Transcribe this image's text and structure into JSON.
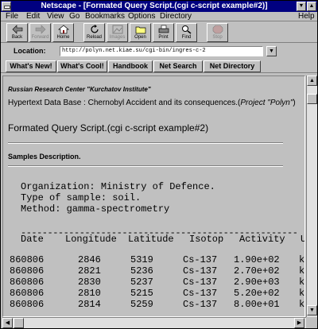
{
  "window": {
    "title": "Netscape - [Formated Query Script.(cgi c-script example#2)]",
    "minimize_glyph": "▼",
    "maximize_glyph": "▲"
  },
  "menu": [
    "File",
    "Edit",
    "View",
    "Go",
    "Bookmarks",
    "Options",
    "Directory",
    "Help"
  ],
  "toolbar": [
    {
      "label": "Back",
      "icon": "back-arrow-icon",
      "enabled": true
    },
    {
      "label": "Forward",
      "icon": "forward-arrow-icon",
      "enabled": false
    },
    {
      "label": "Home",
      "icon": "home-icon",
      "enabled": true
    },
    {
      "label": "Reload",
      "icon": "reload-icon",
      "enabled": true
    },
    {
      "label": "Images",
      "icon": "images-icon",
      "enabled": false
    },
    {
      "label": "Open",
      "icon": "open-icon",
      "enabled": true
    },
    {
      "label": "Print",
      "icon": "print-icon",
      "enabled": true
    },
    {
      "label": "Find",
      "icon": "find-icon",
      "enabled": true
    },
    {
      "label": "Stop",
      "icon": "stop-icon",
      "enabled": false
    }
  ],
  "location": {
    "label": "Location:",
    "url": "http://polyn.net.kiae.su/cgi-bin/ingres-c-2"
  },
  "directory_buttons": [
    "What's New!",
    "What's Cool!",
    "Handbook",
    "Net Search",
    "Net Directory"
  ],
  "content": {
    "organization": "Russian Research Center \"Kurchatov Institute\"",
    "hyperlink_prefix": "Hypertext Data Base : Chernobyl Accident and its consequences.(",
    "project_name": "Project \"Polyn\"",
    "hyperlink_suffix": ")",
    "heading": "Formated Query Script.(cgi c-script example#2)",
    "samples_title": "Samples Description.",
    "pre_lines": [
      "Organization: Ministry of Defence.",
      "Type of sample: soil.",
      "Method: gamma-spectrometry"
    ],
    "dashes": "----------------------------------------------------",
    "table": {
      "headers": [
        "Date",
        "Longitude",
        "Latitude",
        "Isotop",
        "Activity",
        "U"
      ],
      "rows": [
        [
          "860806",
          "2846",
          "5319",
          "Cs-137",
          "1.90e+02",
          "kBq"
        ],
        [
          "860806",
          "2821",
          "5236",
          "Cs-137",
          "2.70e+02",
          "kBq"
        ],
        [
          "860806",
          "2830",
          "5237",
          "Cs-137",
          "2.90e+03",
          "kBq"
        ],
        [
          "860806",
          "2810",
          "5215",
          "Cs-137",
          "5.20e+02",
          "kBq"
        ],
        [
          "860806",
          "2814",
          "5259",
          "Cs-137",
          "8.00e+01",
          "kBq"
        ]
      ]
    }
  },
  "scroll": {
    "up": "▲",
    "down": "▼",
    "left": "◀",
    "right": "▶"
  }
}
